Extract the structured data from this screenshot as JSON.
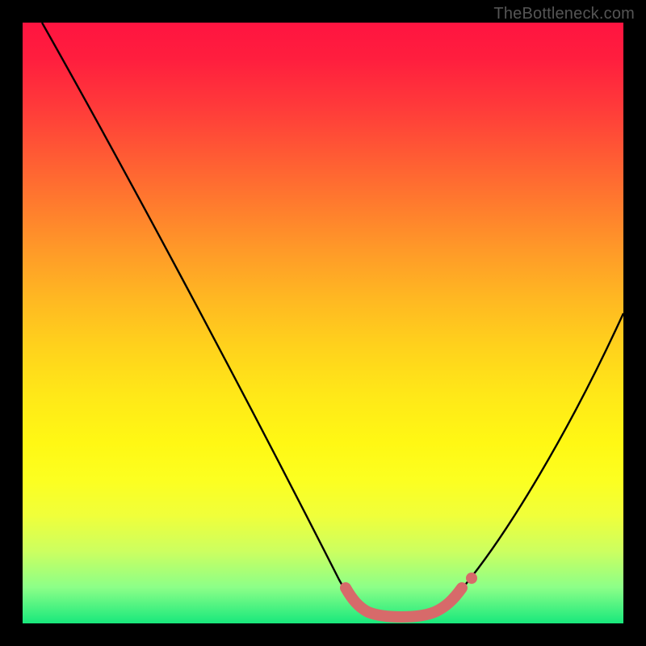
{
  "watermark": "TheBottleneck.com",
  "chart_data": {
    "type": "line",
    "title": "",
    "xlabel": "",
    "ylabel": "",
    "xlim": [
      0,
      100
    ],
    "ylim": [
      0,
      100
    ],
    "grid": false,
    "legend": false,
    "series": [
      {
        "name": "bottleneck-curve",
        "x": [
          3,
          10,
          20,
          30,
          40,
          50,
          54,
          58,
          62,
          66,
          70,
          74,
          80,
          90,
          100
        ],
        "y": [
          100,
          87,
          70,
          53,
          36,
          18,
          10,
          4,
          2,
          2,
          4,
          8,
          20,
          40,
          60
        ]
      },
      {
        "name": "highlight-band",
        "x": [
          54,
          58,
          62,
          66,
          70,
          73
        ],
        "y": [
          9,
          4,
          2,
          2,
          4,
          8
        ]
      }
    ],
    "colors": {
      "curve": "#000000",
      "highlight": "#d76a6a",
      "gradient_top": "#ff1440",
      "gradient_bottom": "#18e87c"
    }
  }
}
